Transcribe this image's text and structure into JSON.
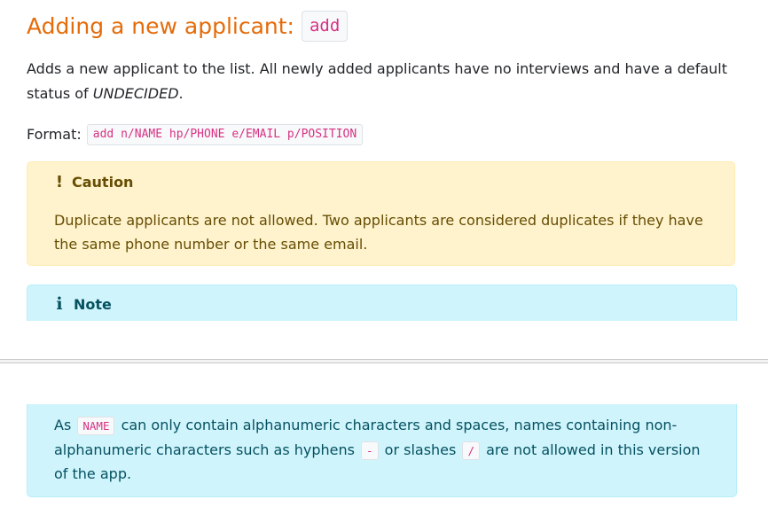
{
  "heading": {
    "text": "Adding a new applicant:",
    "command": "add"
  },
  "description": {
    "text": "Adds a new applicant to the list. All newly added applicants have no interviews and have a default status of ",
    "status": "UNDECIDED",
    "end": "."
  },
  "format": {
    "label": "Format:",
    "code": "add n/NAME hp/PHONE e/EMAIL p/POSITION"
  },
  "caution": {
    "icon": "!",
    "title": "Caution",
    "body": "Duplicate applicants are not allowed. Two applicants are considered duplicates if they have the same phone number or the same email."
  },
  "note": {
    "icon": "i",
    "title": "Note",
    "body_1": "As ",
    "code_name": "NAME",
    "body_2": " can only contain alphanumeric characters and spaces, names containing non-alphanumeric characters such as hyphens ",
    "code_hyphen": "-",
    "body_3": " or slashes ",
    "code_slash": "/",
    "body_4": " are not allowed in this version of the app."
  },
  "colors": {
    "heading": "#e46c0a",
    "code_text": "#d63384",
    "caution_bg": "#fff3cd",
    "note_bg": "#cff4fc"
  }
}
